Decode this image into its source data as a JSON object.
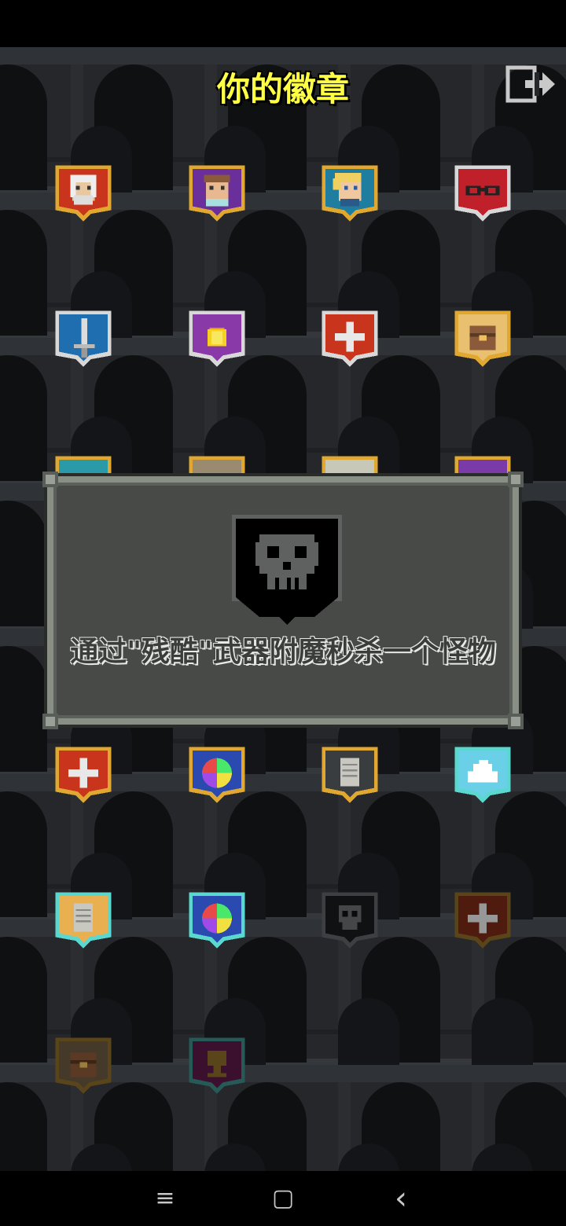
{
  "title": "你的徽章",
  "exit_icon": "exit-door-icon",
  "badge_rows": [
    [
      {
        "name": "badge-warrior",
        "icon": "warrior-portrait-icon",
        "frame": "gold",
        "bg": "#c8351c"
      },
      {
        "name": "badge-mage",
        "icon": "mage-portrait-icon",
        "frame": "gold",
        "bg": "#6a2f9a"
      },
      {
        "name": "badge-rogue",
        "icon": "rogue-portrait-icon",
        "frame": "gold",
        "bg": "#1f7ea0"
      },
      {
        "name": "badge-huntress",
        "icon": "mask-icon",
        "frame": "silver",
        "bg": "#c0202a"
      }
    ],
    [
      {
        "name": "badge-sword",
        "icon": "sword-icon",
        "frame": "silver",
        "bg": "#1f6fb0"
      },
      {
        "name": "badge-gold",
        "icon": "gold-coin-icon",
        "frame": "silver",
        "bg": "#8a3aa8"
      },
      {
        "name": "badge-health",
        "icon": "cross-icon",
        "frame": "silver",
        "bg": "#c8351c"
      },
      {
        "name": "badge-food",
        "icon": "chest-icon",
        "frame": "gold",
        "bg": "#e8c070"
      }
    ],
    [
      {
        "name": "badge-row3-1",
        "icon": "badge-icon",
        "frame": "gold",
        "bg": "#2a9aa8"
      },
      {
        "name": "badge-row3-2",
        "icon": "badge-icon",
        "frame": "gold",
        "bg": "#9a8a70"
      },
      {
        "name": "badge-row3-3",
        "icon": "badge-icon",
        "frame": "gold",
        "bg": "#c8c8b8"
      },
      {
        "name": "badge-row3-4",
        "icon": "badge-icon",
        "frame": "gold",
        "bg": "#7a3aa8"
      }
    ],
    [],
    [
      {
        "name": "badge-health-gold",
        "icon": "cross-icon",
        "frame": "gold",
        "bg": "#c8351c"
      },
      {
        "name": "badge-potions",
        "icon": "potion-wheel-icon",
        "frame": "gold",
        "bg": "#2a4ab0"
      },
      {
        "name": "badge-scroll",
        "icon": "scroll-icon",
        "frame": "gold",
        "bg": "#3a3d40"
      },
      {
        "name": "badge-cloud",
        "icon": "cloud-icon",
        "frame": "cyan",
        "bg": "#6ad0e8"
      }
    ],
    [
      {
        "name": "badge-scroll-cyan",
        "icon": "scroll-icon",
        "frame": "cyan",
        "bg": "#e8b050"
      },
      {
        "name": "badge-potions-cyan",
        "icon": "potion-wheel-icon",
        "frame": "cyan",
        "bg": "#2a4ab0"
      },
      {
        "name": "badge-skull",
        "icon": "skull-icon",
        "frame": "gray",
        "bg": "#1a1b1d"
      },
      {
        "name": "badge-health-dim",
        "icon": "cross-icon",
        "frame": "dimgold",
        "bg": "#7a2a18"
      }
    ],
    [
      {
        "name": "badge-chest-dim",
        "icon": "chest-icon",
        "frame": "dimgold",
        "bg": "#6a5a40"
      },
      {
        "name": "badge-trophy-dim",
        "icon": "trophy-icon",
        "frame": "dimcyan",
        "bg": "#5a1a48"
      }
    ]
  ],
  "dialog": {
    "icon": "skull-icon",
    "text": "通过\"残酷\"武器附魔秒杀一个怪物"
  },
  "navbar": {
    "menu_icon": "menu-icon",
    "home_icon": "home-square-icon",
    "back_icon": "back-chevron-icon",
    "menu_glyph": "≡",
    "home_glyph": "▢",
    "back_glyph": "‹"
  },
  "colors": {
    "gold_frame": "#e0a830",
    "silver_frame": "#d8d8d8",
    "cyan_frame": "#5ad8d0",
    "gray_frame": "#606266",
    "title": "#ffff44"
  }
}
